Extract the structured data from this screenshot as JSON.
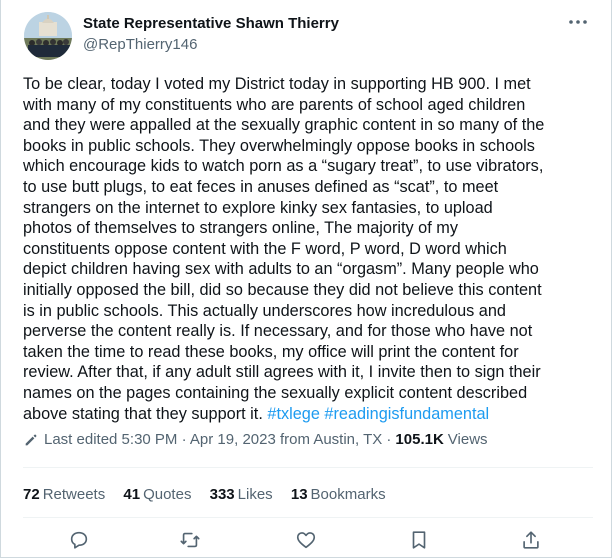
{
  "author": {
    "display_name": "State Representative Shawn Thierry",
    "handle": "@RepThierry146"
  },
  "tweet": {
    "text": "To be clear, today I voted my District today in supporting HB 900. I met\nwith many of my constituents who are parents of school aged children\nand they were appalled at the sexually graphic content in so many of the\nbooks in public schools. They overwhelmingly oppose books in schools\nwhich encourage kids to watch porn as a “sugary treat”, to use vibrators,\nto use butt plugs, to eat feces in anuses defined as “scat”, to meet\nstrangers on the internet to explore kinky sex fantasies, to upload\nphotos of themselves to strangers online,  The majority of my\nconstituents oppose content with the F word, P word, D word which\ndepict  children having sex with adults to an “orgasm”. Many people  who\ninitially opposed the bill, did so because they did not believe this content\nis in public schools. This actually underscores how incredulous and\nperverse the content really is.  If necessary, and for those who have not\ntaken the time to read these books, my office will print the content for\nreview. After that, if any adult still  agrees with it, I invite then to sign their\nnames on the pages containing the sexually explicit content described\nabove stating that they support it.",
    "hashtags": "#txlege #readingisfundamental"
  },
  "meta": {
    "edited": "Last edited 5:30 PM · Apr 19, 2023 from Austin, TX ·",
    "views_count": "105.1K",
    "views_label": "Views"
  },
  "stats": {
    "retweets_count": "72",
    "retweets_label": "Retweets",
    "quotes_count": "41",
    "quotes_label": "Quotes",
    "likes_count": "333",
    "likes_label": "Likes",
    "bookmarks_count": "13",
    "bookmarks_label": "Bookmarks"
  },
  "icons": {
    "more": "more-horizontal-icon",
    "edited": "pencil-icon",
    "reply": "reply-icon",
    "retweet": "retweet-icon",
    "like": "heart-icon",
    "bookmark": "bookmark-icon",
    "share": "share-icon"
  },
  "colors": {
    "text": "#0f1419",
    "secondary": "#536471",
    "link": "#1d9bf0",
    "divider": "#eff3f4"
  }
}
